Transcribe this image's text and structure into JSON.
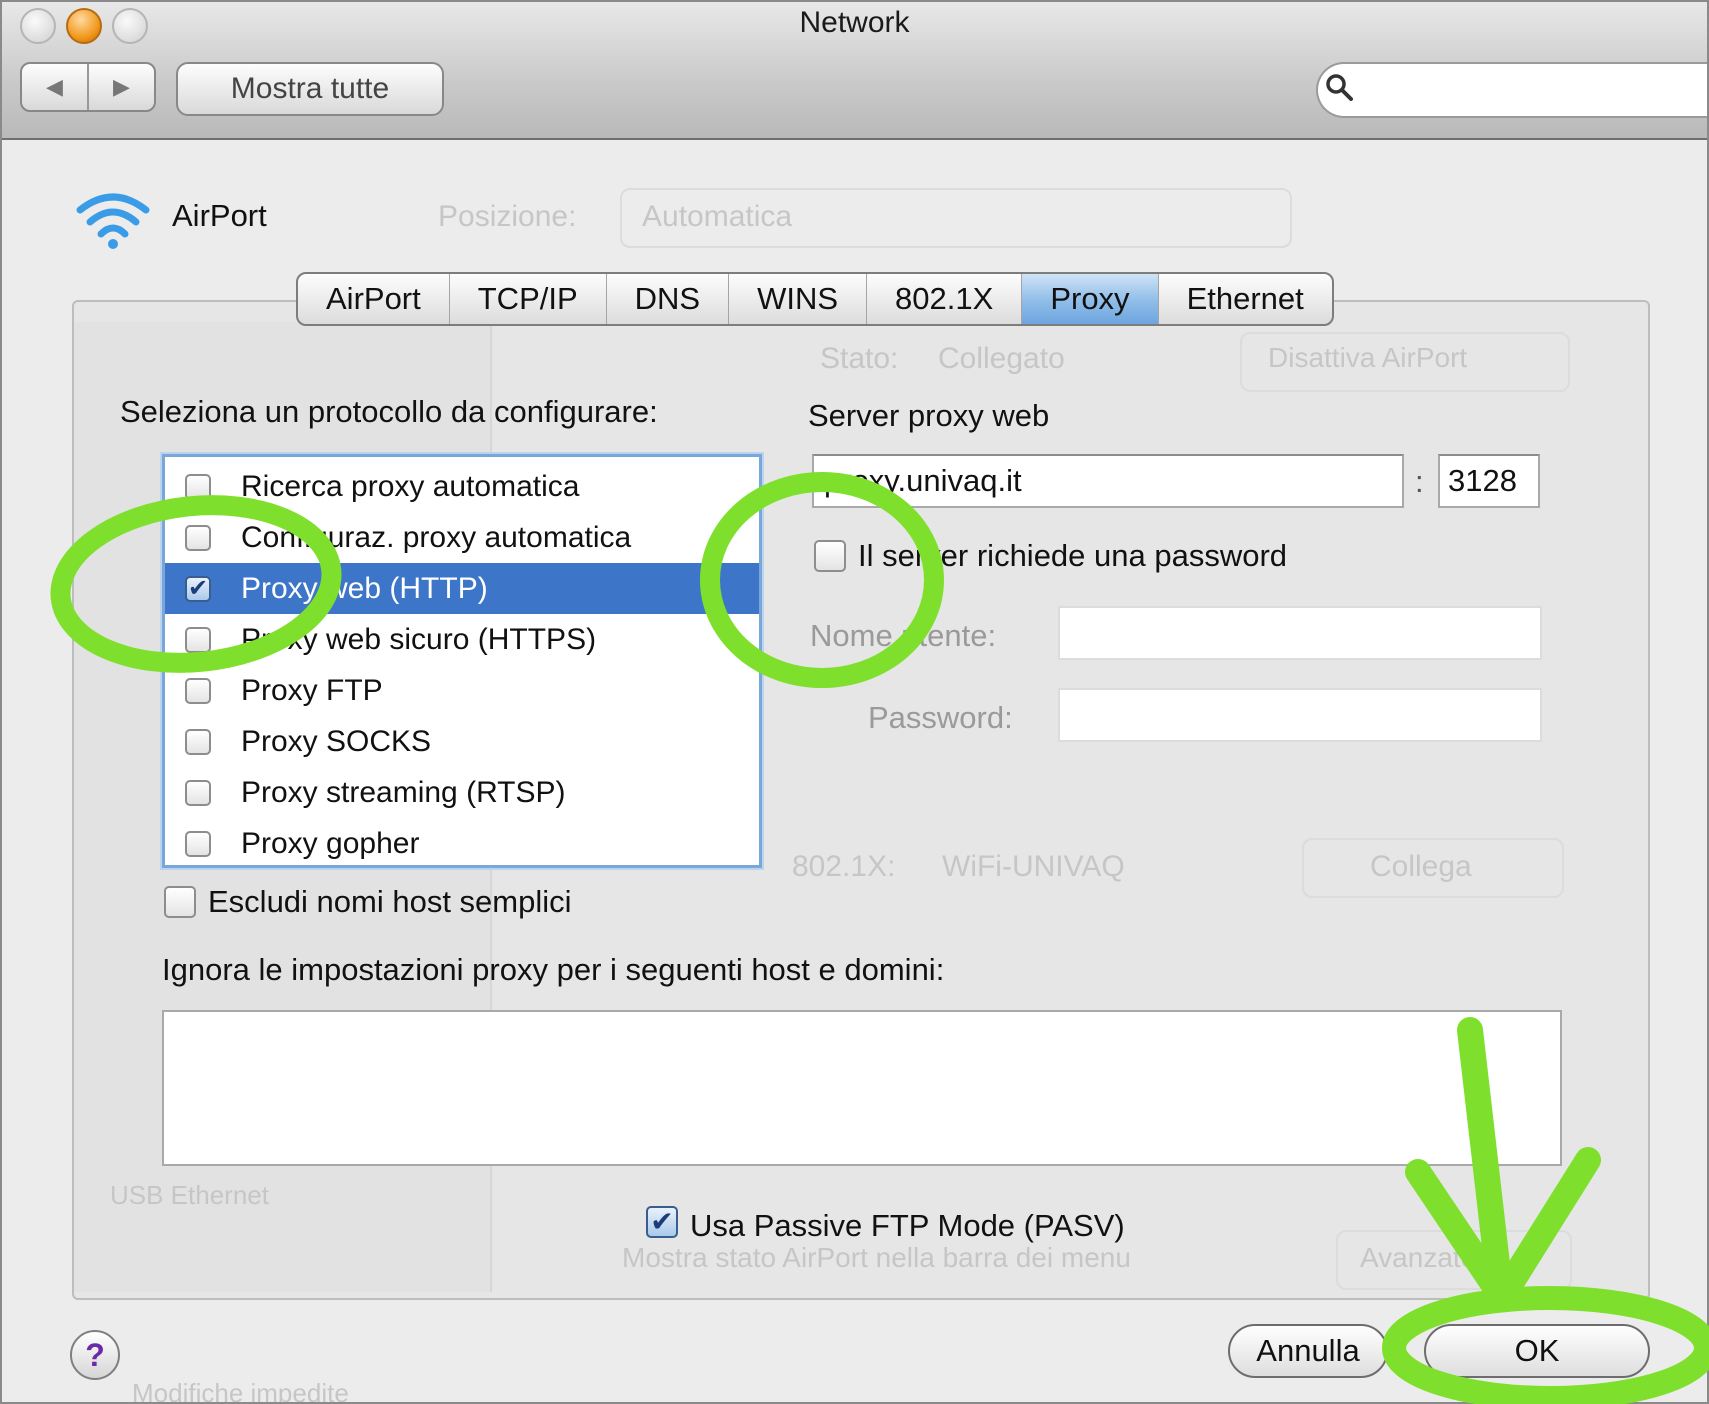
{
  "window": {
    "title": "Network"
  },
  "toolbar": {
    "back_arrow": "◀",
    "forward_arrow": "▶",
    "show_all_label": "Mostra tutte",
    "search_placeholder": ""
  },
  "service": {
    "name": "AirPort",
    "icon": "wifi-icon"
  },
  "background_ghost": {
    "location_label": "Posizione:",
    "location_value": "Automatica",
    "status_label": "Stato:",
    "status_value": "Collegato",
    "turn_off_button": "Disattiva AirPort",
    "network_label": "802.1X:",
    "network_value": "WiFi-UNIVAQ",
    "connect_button": "Collega",
    "sidebar_item": "USB Ethernet",
    "show_status": "Mostra stato AirPort nella barra dei menu",
    "advanced_button": "Avanzate",
    "lock_text": "Modifiche impedite"
  },
  "tabs": [
    {
      "label": "AirPort",
      "active": false
    },
    {
      "label": "TCP/IP",
      "active": false
    },
    {
      "label": "DNS",
      "active": false
    },
    {
      "label": "WINS",
      "active": false
    },
    {
      "label": "802.1X",
      "active": false
    },
    {
      "label": "Proxy",
      "active": true
    },
    {
      "label": "Ethernet",
      "active": false
    }
  ],
  "protocols": {
    "heading": "Seleziona un protocollo da configurare:",
    "items": [
      {
        "label": "Ricerca proxy automatica",
        "checked": false,
        "selected": false
      },
      {
        "label": "Configuraz. proxy automatica",
        "checked": false,
        "selected": false
      },
      {
        "label": "Proxy web (HTTP)",
        "checked": true,
        "selected": true
      },
      {
        "label": "Proxy web sicuro (HTTPS)",
        "checked": false,
        "selected": false
      },
      {
        "label": "Proxy FTP",
        "checked": false,
        "selected": false
      },
      {
        "label": "Proxy SOCKS",
        "checked": false,
        "selected": false
      },
      {
        "label": "Proxy streaming (RTSP)",
        "checked": false,
        "selected": false
      },
      {
        "label": "Proxy gopher",
        "checked": false,
        "selected": false
      }
    ]
  },
  "proxy_server": {
    "heading": "Server proxy web",
    "host_value": "proxy.univaq.it",
    "port_separator": ":",
    "port_value": "3128",
    "requires_password_label": "Il server richiede una password",
    "requires_password_checked": false,
    "username_label": "Nome utente:",
    "username_value": "",
    "password_label": "Password:",
    "password_value": ""
  },
  "exclude_simple_hosts": {
    "label": "Escludi nomi host semplici",
    "checked": false
  },
  "bypass": {
    "label": "Ignora le impostazioni proxy per i seguenti host e domini:",
    "value": ""
  },
  "passive_ftp": {
    "label": "Usa Passive FTP Mode (PASV)",
    "checked": true
  },
  "footer": {
    "help_label": "?",
    "cancel_label": "Annulla",
    "ok_label": "OK"
  },
  "annotations": {
    "color": "#7ee02c",
    "circled": [
      "Proxy web (HTTP)",
      "Il server richiede una password"
    ],
    "arrow_target": "OK"
  },
  "colors": {
    "selection": "#3d76c9",
    "active_tab": "#8fbce8",
    "highlight_marker": "#7ee02c"
  }
}
